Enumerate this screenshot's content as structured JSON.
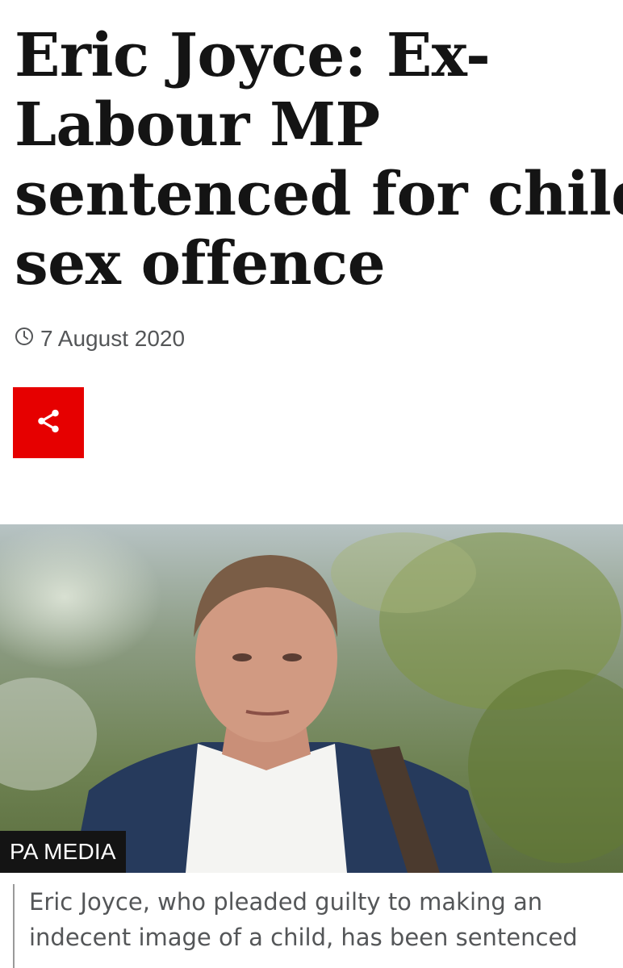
{
  "headline": {
    "lines": [
      "Eric Joyce: Ex-",
      "Labour MP",
      "sentenced for child",
      "sex offence"
    ]
  },
  "meta": {
    "date": "7 August 2020",
    "clock_icon": "clock-icon"
  },
  "share": {
    "icon": "share-icon",
    "color": "#e60000"
  },
  "image": {
    "credit": "PA MEDIA",
    "caption_lines": [
      "Eric Joyce, who pleaded guilty to making an",
      "indecent image of a child, has been sentenced"
    ]
  }
}
